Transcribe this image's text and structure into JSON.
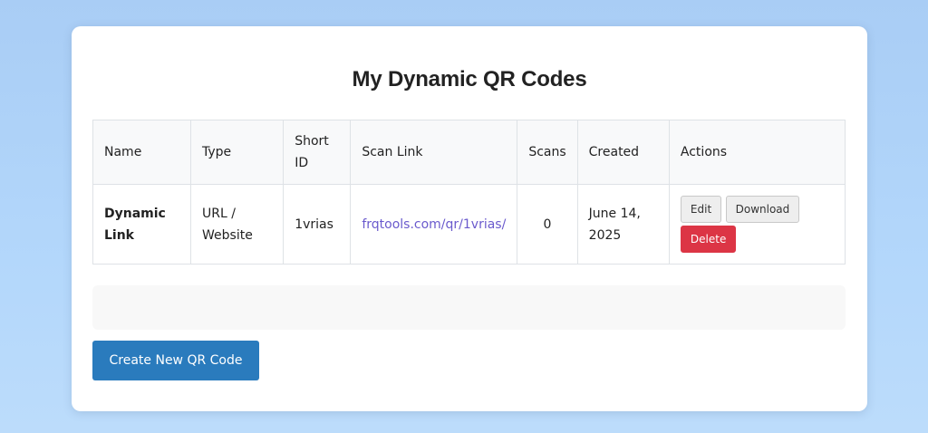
{
  "page": {
    "title": "My Dynamic QR Codes"
  },
  "table": {
    "headers": {
      "name": "Name",
      "type": "Type",
      "short_id": "Short ID",
      "scan_link": "Scan Link",
      "scans": "Scans",
      "created": "Created",
      "actions": "Actions"
    },
    "rows": [
      {
        "name": "Dynamic Link",
        "type": "URL / Website",
        "short_id": "1vrias",
        "scan_link": "frqtools.com/qr/1vrias/",
        "scans": "0",
        "created": "June 14, 2025",
        "edit_label": "Edit",
        "download_label": "Download",
        "delete_label": "Delete"
      }
    ]
  },
  "create_button": {
    "label": "Create New QR Code"
  },
  "colors": {
    "accent": "#2a7bbd",
    "danger": "#dc3545",
    "link": "#6a5acd",
    "background": "#b3d7fb"
  }
}
